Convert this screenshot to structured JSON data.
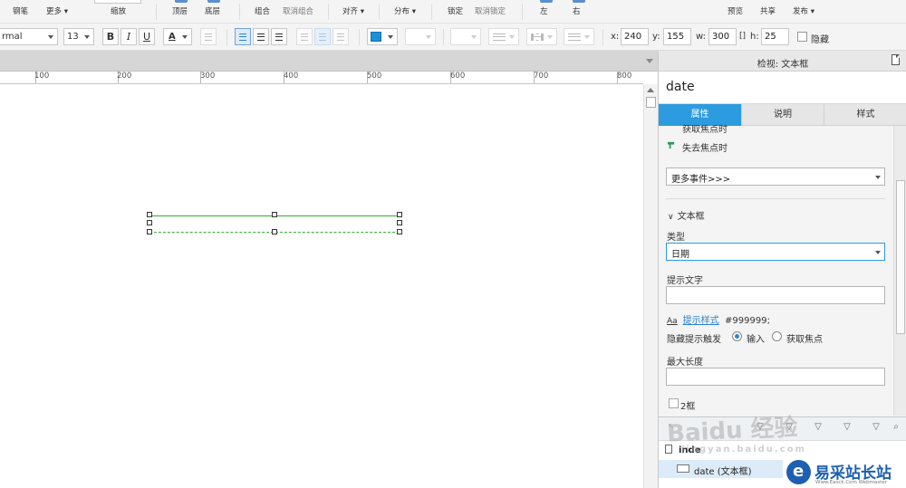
{
  "toolbar": {
    "row1": [
      "钢笔",
      "更多 ▾",
      "缩放",
      "顶层",
      "底层",
      "组合",
      "取消组合",
      "对齐 ▾",
      "分布 ▾",
      "锁定",
      "取消锁定",
      "左",
      "右",
      "预览",
      "共享",
      "发布 ▾"
    ],
    "style_value": "rmal",
    "font_size": "13",
    "bold": "B",
    "italic": "I",
    "underline": "U",
    "font_color_glyph": "A",
    "x_label": "x:",
    "x_value": "240",
    "y_label": "y:",
    "y_value": "155",
    "w_label": "w:",
    "w_value": "300",
    "h_label": "h:",
    "h_value": "25",
    "hide_label": "隐藏",
    "fill_color": "#1d8fd8"
  },
  "ruler": [
    "100",
    "200",
    "300",
    "400",
    "500",
    "600",
    "700",
    "800"
  ],
  "panel": {
    "title": "检视: 文本框",
    "widget_name": "date",
    "tabs": [
      "属性",
      "说明",
      "样式"
    ],
    "events": [
      "获取焦点时",
      "失去焦点时"
    ],
    "more_events": "更多事件>>>",
    "section_title": "文本框",
    "type_label": "类型",
    "type_value": "日期",
    "hint_label": "提示文字",
    "hint_style_aa": "Aa",
    "hint_style_link": "提示样式",
    "hint_color": "#999999;",
    "hide_trigger_label": "隐藏提示触发",
    "trigger_input": "输入",
    "trigger_focus": "获取焦点",
    "maxlen_label": "最大长度",
    "bottom_checkbox_label": "2框"
  },
  "outline": {
    "rows": [
      "inde",
      "date (文本框)"
    ]
  },
  "watermark": {
    "brand": "易采站长站",
    "sub": "Www.Easck.Com  Webmaster",
    "jingyan": "Baidu 经验",
    "jingyan_url": "jingyan.baidu.com"
  },
  "colors": {
    "accent": "#2c9be0",
    "selection_green": "#2fb32f"
  }
}
